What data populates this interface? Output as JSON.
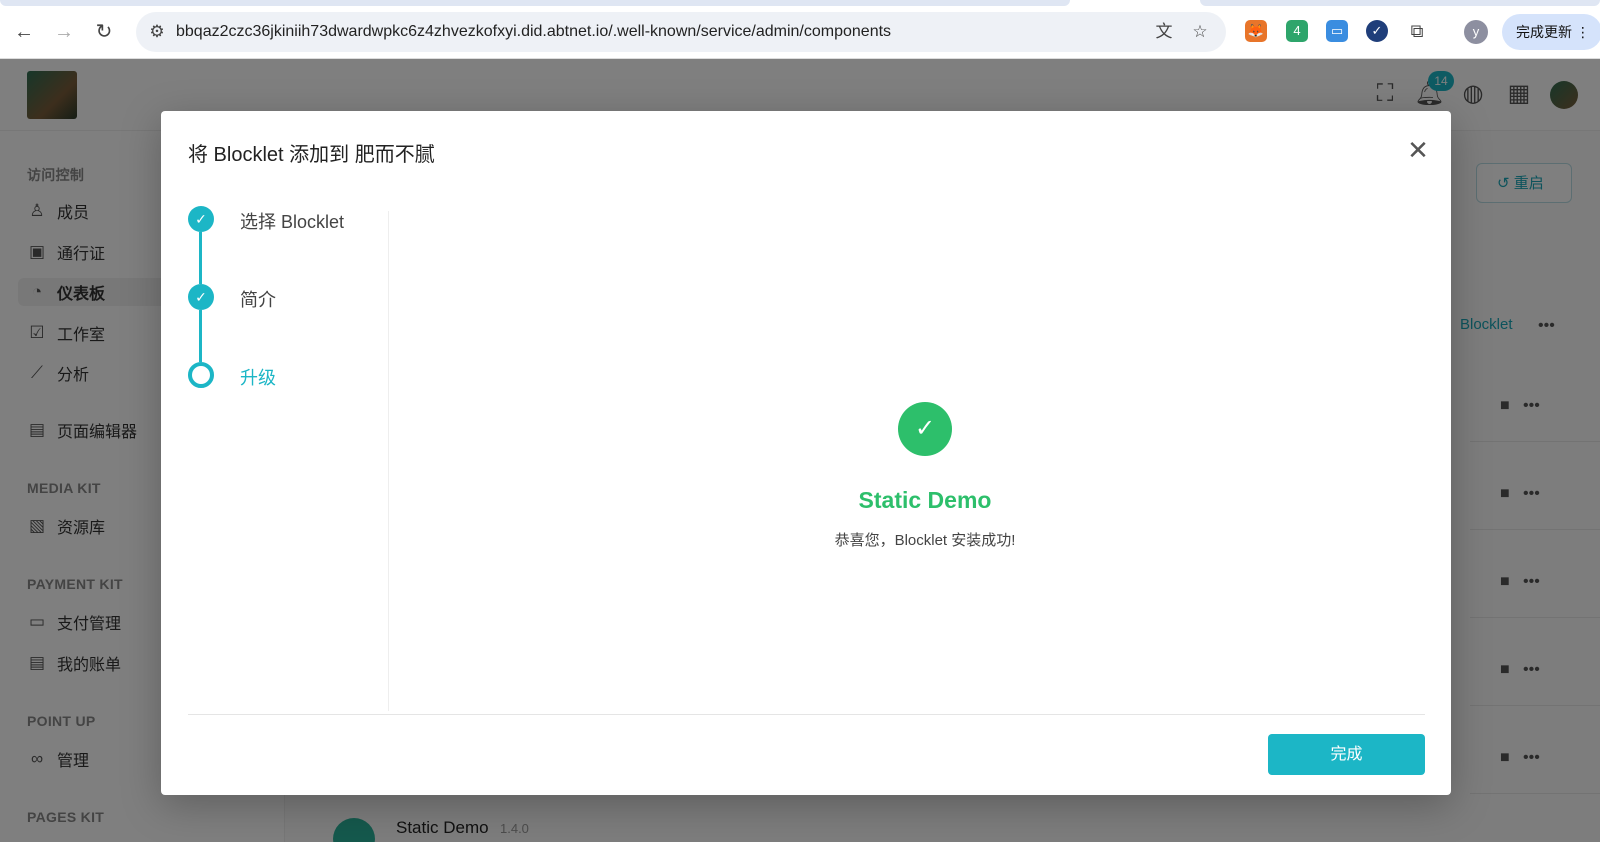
{
  "browser": {
    "url": "bbqaz2czc36jkiniih73dwardwpkc6z4zhvezkofxyi.did.abtnet.io/.well-known/service/admin/components",
    "update_label": "完成更新",
    "profile_initial": "y",
    "icons": [
      "back-icon",
      "forward-icon",
      "reload-icon",
      "site-info-icon",
      "translate-icon",
      "bookmark-star-icon",
      "metamask-icon",
      "extension-4-icon",
      "screen-icon",
      "check-extension-icon",
      "puzzle-icon",
      "menu-icon"
    ],
    "extension_badge": "4"
  },
  "header": {
    "notification_count": "14"
  },
  "sidebar": {
    "groups": [
      {
        "title": "访问控制",
        "items": [
          "成员",
          "通行证",
          "仪表板",
          "工作室",
          "分析"
        ]
      },
      {
        "title": "",
        "items": [
          "页面编辑器"
        ]
      },
      {
        "title": "MEDIA KIT",
        "items": [
          "资源库"
        ]
      },
      {
        "title": "PAYMENT KIT",
        "items": [
          "支付管理",
          "我的账单"
        ]
      },
      {
        "title": "POINT UP",
        "items": [
          "管理"
        ]
      },
      {
        "title": "PAGES KIT",
        "items": []
      }
    ]
  },
  "main": {
    "restart_label": "重启",
    "add_blocklet_label": "Blocklet",
    "bottom_app_name": "Static Demo",
    "bottom_app_version": "1.4.0"
  },
  "dialog": {
    "title": "将 Blocklet 添加到 肥而不腻",
    "steps": [
      {
        "label": "选择 Blocklet",
        "status": "done"
      },
      {
        "label": "简介",
        "status": "done"
      },
      {
        "label": "升级",
        "status": "current"
      }
    ],
    "result": {
      "title": "Static Demo",
      "message": "恭喜您，Blocklet 安装成功!"
    },
    "done_label": "完成"
  },
  "colors": {
    "accent": "#1cb6c6",
    "success": "#2dbf6b"
  }
}
